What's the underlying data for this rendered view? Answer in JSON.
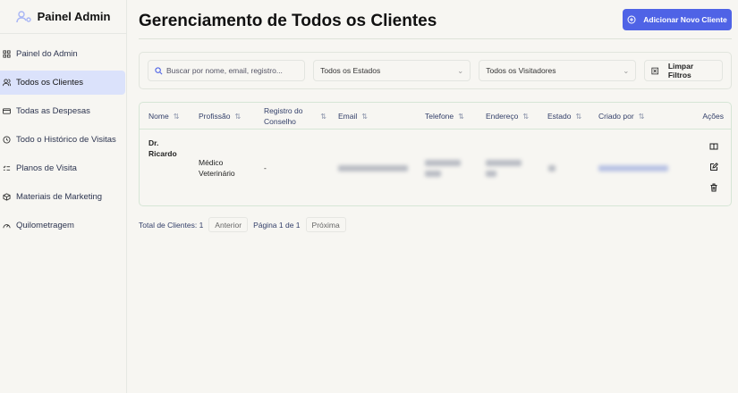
{
  "sidebar": {
    "brand": "Painel Admin",
    "items": [
      {
        "label": "Painel do Admin",
        "icon": "grid-icon",
        "active": false
      },
      {
        "label": "Todos os Clientes",
        "icon": "users-icon",
        "active": true
      },
      {
        "label": "Todas as Despesas",
        "icon": "wallet-icon",
        "active": false
      },
      {
        "label": "Todo o Histórico de Visitas",
        "icon": "history-icon",
        "active": false
      },
      {
        "label": "Planos de Visita",
        "icon": "list-check-icon",
        "active": false
      },
      {
        "label": "Materiais de Marketing",
        "icon": "package-icon",
        "active": false
      },
      {
        "label": "Quilometragem",
        "icon": "gauge-icon",
        "active": false
      }
    ]
  },
  "header": {
    "title": "Gerenciamento de Todos os Clientes",
    "add_button": "Adicionar Novo Cliente"
  },
  "filters": {
    "search_placeholder": "Buscar por nome, email, registro...",
    "state_select": "Todos os Estados",
    "visitor_select": "Todos os Visitadores",
    "clear_button": "Limpar Filtros"
  },
  "table": {
    "columns": [
      "Nome",
      "Profissão",
      "Registro do Conselho",
      "Email",
      "Telefone",
      "Endereço",
      "Estado",
      "Criado por",
      "Ações"
    ],
    "rows": [
      {
        "nome": "Dr. Ricardo",
        "profissao": "Médico Veterinário",
        "registro": "-"
      }
    ]
  },
  "pagination": {
    "total": "Total de Clientes: 1",
    "prev": "Anterior",
    "page": "Página 1 de 1",
    "next": "Próxima"
  },
  "colors": {
    "accent": "#4f63e6",
    "active_nav": "#dbe2fb"
  }
}
